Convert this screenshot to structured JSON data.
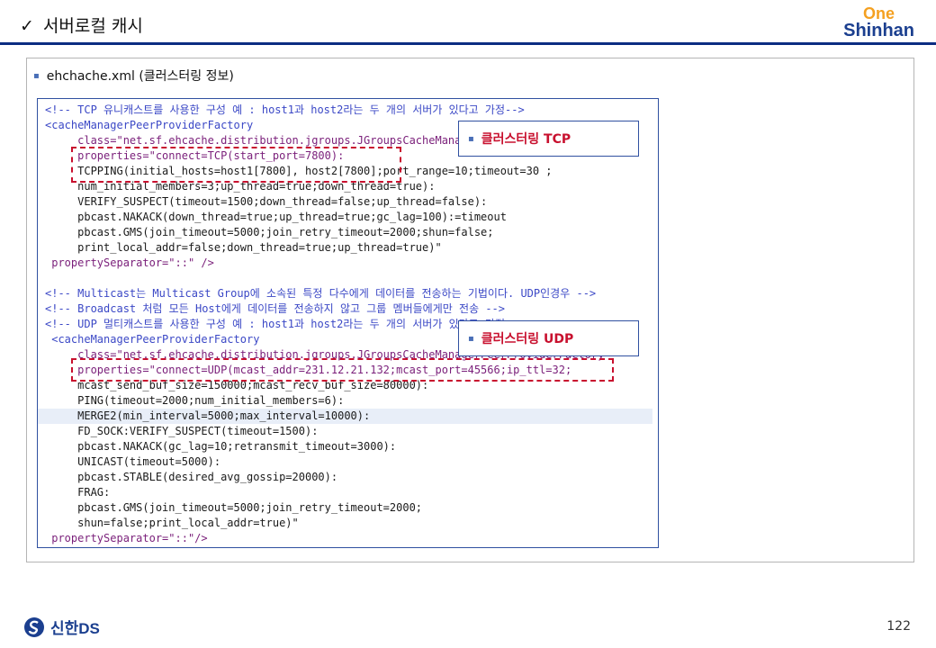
{
  "header": {
    "check_icon": "✓",
    "title": "서버로컬 캐시",
    "logo_one": "One",
    "logo_brand": "Shinhan"
  },
  "section": {
    "label": "ehchache.xml (클러스터링 정보)"
  },
  "callouts": {
    "tcp": "클러스터링 TCP",
    "udp": "클러스터링 UDP"
  },
  "code_lines": [
    "<!-- TCP 유니캐스트를 사용한 구성 예 : host1과 host2라는 두 개의 서버가 있다고 가정-->",
    "<cacheManagerPeerProviderFactory",
    "     class=\"net.sf.ehcache.distribution.jgroups.JGroupsCacheManagerPeerProviderFactory\"",
    "     properties=\"connect=TCP(start_port=7800):",
    "     TCPPING(initial_hosts=host1[7800], host2[7800];port_range=10;timeout=30 ;",
    "     num_initial_members=3;up_thread=true;down_thread=true):",
    "     VERIFY_SUSPECT(timeout=1500;down_thread=false;up_thread=false):",
    "     pbcast.NAKACK(down_thread=true;up_thread=true;gc_lag=100):=timeout",
    "     pbcast.GMS(join_timeout=5000;join_retry_timeout=2000;shun=false;",
    "     print_local_addr=false;down_thread=true;up_thread=true)\"",
    " propertySeparator=\"::\" />",
    "",
    "<!-- Multicast는 Multicast Group에 소속된 특정 다수에게 데이터를 전송하는 기법이다. UDP인경우 -->",
    "<!-- Broadcast 처럼 모든 Host에게 데이터를 전송하지 않고 그룹 멤버들에게만 전송 -->",
    "<!-- UDP 멀티캐스트를 사용한 구성 예 : host1과 host2라는 두 개의 서버가 있다고 가정-->",
    " <cacheManagerPeerProviderFactory",
    "     class=\"net.sf.ehcache.distribution.jgroups.JGroupsCacheManagerPeerProviderFactory\"",
    "     properties=\"connect=UDP(mcast_addr=231.12.21.132;mcast_port=45566;ip_ttl=32;",
    "     mcast_send_buf_size=150000;mcast_recv_buf_size=80000):",
    "     PING(timeout=2000;num_initial_members=6):",
    "     MERGE2(min_interval=5000;max_interval=10000):",
    "     FD_SOCK:VERIFY_SUSPECT(timeout=1500):",
    "     pbcast.NAKACK(gc_lag=10;retransmit_timeout=3000):",
    "     UNICAST(timeout=5000):",
    "     pbcast.STABLE(desired_avg_gossip=20000):",
    "     FRAG:",
    "     pbcast.GMS(join_timeout=5000;join_retry_timeout=2000;",
    "     shun=false;print_local_addr=true)\"",
    " propertySeparator=\"::\"/>"
  ],
  "footer": {
    "company": "신한DS",
    "page_number": "122"
  },
  "colors": {
    "accent": "#0c2d82",
    "highlight_red": "#c8102e",
    "logo_orange": "#f4a020"
  }
}
